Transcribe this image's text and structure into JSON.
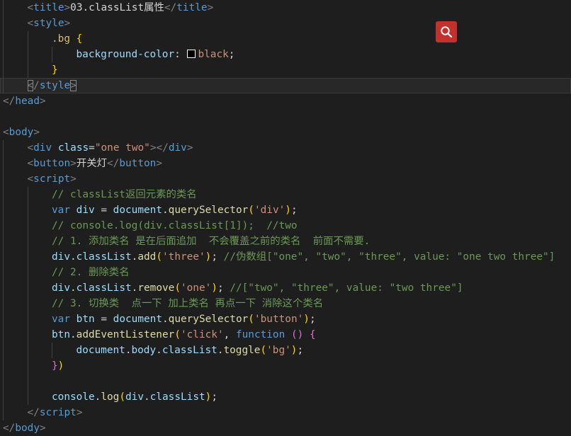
{
  "lines": [
    {
      "indent": 1,
      "tokens": [
        {
          "t": "<",
          "c": "t-tag"
        },
        {
          "t": "title",
          "c": "t-tagname"
        },
        {
          "t": ">",
          "c": "t-tag"
        },
        {
          "t": "03.classList属性",
          "c": "t-text"
        },
        {
          "t": "</",
          "c": "t-tag"
        },
        {
          "t": "title",
          "c": "t-tagname"
        },
        {
          "t": ">",
          "c": "t-tag"
        }
      ]
    },
    {
      "indent": 1,
      "tokens": [
        {
          "t": "<",
          "c": "t-tag"
        },
        {
          "t": "style",
          "c": "t-tagname"
        },
        {
          "t": ">",
          "c": "t-tag"
        }
      ]
    },
    {
      "indent": 2,
      "tokens": [
        {
          "t": ".bg",
          "c": "t-sel"
        },
        {
          "t": " ",
          "c": "t-punc"
        },
        {
          "t": "{",
          "c": "t-brace"
        }
      ]
    },
    {
      "indent": 3,
      "tokens": [
        {
          "t": "background-color",
          "c": "t-prop"
        },
        {
          "t": ": ",
          "c": "t-punc"
        },
        {
          "swatch": true
        },
        {
          "t": "black",
          "c": "t-str"
        },
        {
          "t": ";",
          "c": "t-punc"
        }
      ]
    },
    {
      "indent": 2,
      "tokens": [
        {
          "t": "}",
          "c": "t-brace"
        }
      ]
    },
    {
      "indent": 1,
      "current": true,
      "tokens": [
        {
          "t": "<",
          "c": "t-tag",
          "hl": true
        },
        {
          "t": "/",
          "c": "t-tag"
        },
        {
          "t": "style",
          "c": "t-tagname"
        },
        {
          "t": ">",
          "c": "t-tag",
          "hl": true
        }
      ]
    },
    {
      "indent": 0,
      "tokens": [
        {
          "t": "</",
          "c": "t-tag"
        },
        {
          "t": "head",
          "c": "t-tagname"
        },
        {
          "t": ">",
          "c": "t-tag"
        }
      ]
    },
    {
      "indent": 0,
      "tokens": []
    },
    {
      "indent": 0,
      "tokens": [
        {
          "t": "<",
          "c": "t-tag"
        },
        {
          "t": "body",
          "c": "t-tagname"
        },
        {
          "t": ">",
          "c": "t-tag"
        }
      ]
    },
    {
      "indent": 1,
      "tokens": [
        {
          "t": "<",
          "c": "t-tag"
        },
        {
          "t": "div",
          "c": "t-tagname"
        },
        {
          "t": " ",
          "c": "t-punc"
        },
        {
          "t": "class",
          "c": "t-attr"
        },
        {
          "t": "=",
          "c": "t-punc"
        },
        {
          "t": "\"one two\"",
          "c": "t-str"
        },
        {
          "t": "></",
          "c": "t-tag"
        },
        {
          "t": "div",
          "c": "t-tagname"
        },
        {
          "t": ">",
          "c": "t-tag"
        }
      ]
    },
    {
      "indent": 1,
      "tokens": [
        {
          "t": "<",
          "c": "t-tag"
        },
        {
          "t": "button",
          "c": "t-tagname"
        },
        {
          "t": ">",
          "c": "t-tag"
        },
        {
          "t": "开关灯",
          "c": "t-text"
        },
        {
          "t": "</",
          "c": "t-tag"
        },
        {
          "t": "button",
          "c": "t-tagname"
        },
        {
          "t": ">",
          "c": "t-tag"
        }
      ]
    },
    {
      "indent": 1,
      "tokens": [
        {
          "t": "<",
          "c": "t-tag"
        },
        {
          "t": "script",
          "c": "t-tagname"
        },
        {
          "t": ">",
          "c": "t-tag"
        }
      ]
    },
    {
      "indent": 2,
      "tokens": [
        {
          "t": "// classList返回元素的类名",
          "c": "t-com"
        }
      ]
    },
    {
      "indent": 2,
      "tokens": [
        {
          "t": "var",
          "c": "t-kw"
        },
        {
          "t": " ",
          "c": "t-punc"
        },
        {
          "t": "div",
          "c": "t-var"
        },
        {
          "t": " = ",
          "c": "t-punc"
        },
        {
          "t": "document",
          "c": "t-var"
        },
        {
          "t": ".",
          "c": "t-punc"
        },
        {
          "t": "querySelector",
          "c": "t-fn"
        },
        {
          "t": "(",
          "c": "t-brace"
        },
        {
          "t": "'div'",
          "c": "t-str"
        },
        {
          "t": ")",
          "c": "t-brace"
        },
        {
          "t": ";",
          "c": "t-punc"
        }
      ]
    },
    {
      "indent": 2,
      "tokens": [
        {
          "t": "// console.log(div.classList[1]);  //two",
          "c": "t-com"
        }
      ]
    },
    {
      "indent": 2,
      "tokens": [
        {
          "t": "// 1. 添加类名 是在后面追加  不会覆盖之前的类名  前面不需要.",
          "c": "t-com"
        }
      ]
    },
    {
      "indent": 2,
      "tokens": [
        {
          "t": "div",
          "c": "t-var"
        },
        {
          "t": ".",
          "c": "t-punc"
        },
        {
          "t": "classList",
          "c": "t-var"
        },
        {
          "t": ".",
          "c": "t-punc"
        },
        {
          "t": "add",
          "c": "t-fn"
        },
        {
          "t": "(",
          "c": "t-brace"
        },
        {
          "t": "'three'",
          "c": "t-str"
        },
        {
          "t": ")",
          "c": "t-brace"
        },
        {
          "t": "; ",
          "c": "t-punc"
        },
        {
          "t": "//伪数组[\"one\", \"two\", \"three\", value: \"one two three\"]",
          "c": "t-com"
        }
      ]
    },
    {
      "indent": 2,
      "tokens": [
        {
          "t": "// 2. 删除类名",
          "c": "t-com"
        }
      ]
    },
    {
      "indent": 2,
      "tokens": [
        {
          "t": "div",
          "c": "t-var"
        },
        {
          "t": ".",
          "c": "t-punc"
        },
        {
          "t": "classList",
          "c": "t-var"
        },
        {
          "t": ".",
          "c": "t-punc"
        },
        {
          "t": "remove",
          "c": "t-fn"
        },
        {
          "t": "(",
          "c": "t-brace"
        },
        {
          "t": "'one'",
          "c": "t-str"
        },
        {
          "t": ")",
          "c": "t-brace"
        },
        {
          "t": "; ",
          "c": "t-punc"
        },
        {
          "t": "//[\"two\", \"three\", value: \"two three\"]",
          "c": "t-com"
        }
      ]
    },
    {
      "indent": 2,
      "tokens": [
        {
          "t": "// 3. 切换类  点一下 加上类名 再点一下 消除这个类名",
          "c": "t-com"
        }
      ]
    },
    {
      "indent": 2,
      "tokens": [
        {
          "t": "var",
          "c": "t-kw"
        },
        {
          "t": " ",
          "c": "t-punc"
        },
        {
          "t": "btn",
          "c": "t-var"
        },
        {
          "t": " = ",
          "c": "t-punc"
        },
        {
          "t": "document",
          "c": "t-var"
        },
        {
          "t": ".",
          "c": "t-punc"
        },
        {
          "t": "querySelector",
          "c": "t-fn"
        },
        {
          "t": "(",
          "c": "t-brace"
        },
        {
          "t": "'button'",
          "c": "t-str"
        },
        {
          "t": ")",
          "c": "t-brace"
        },
        {
          "t": ";",
          "c": "t-punc"
        }
      ]
    },
    {
      "indent": 2,
      "tokens": [
        {
          "t": "btn",
          "c": "t-var"
        },
        {
          "t": ".",
          "c": "t-punc"
        },
        {
          "t": "addEventListener",
          "c": "t-fn"
        },
        {
          "t": "(",
          "c": "t-brace"
        },
        {
          "t": "'click'",
          "c": "t-str"
        },
        {
          "t": ", ",
          "c": "t-punc"
        },
        {
          "t": "function",
          "c": "t-kw"
        },
        {
          "t": " ",
          "c": "t-punc"
        },
        {
          "t": "()",
          "c": "t-paren"
        },
        {
          "t": " ",
          "c": "t-punc"
        },
        {
          "t": "{",
          "c": "t-paren"
        }
      ]
    },
    {
      "indent": 3,
      "tokens": [
        {
          "t": "document",
          "c": "t-var"
        },
        {
          "t": ".",
          "c": "t-punc"
        },
        {
          "t": "body",
          "c": "t-var"
        },
        {
          "t": ".",
          "c": "t-punc"
        },
        {
          "t": "classList",
          "c": "t-var"
        },
        {
          "t": ".",
          "c": "t-punc"
        },
        {
          "t": "toggle",
          "c": "t-fn"
        },
        {
          "t": "(",
          "c": "t-brace"
        },
        {
          "t": "'bg'",
          "c": "t-str"
        },
        {
          "t": ")",
          "c": "t-brace"
        },
        {
          "t": ";",
          "c": "t-punc"
        }
      ]
    },
    {
      "indent": 2,
      "tokens": [
        {
          "t": "}",
          "c": "t-paren"
        },
        {
          "t": ")",
          "c": "t-brace"
        }
      ]
    },
    {
      "indent": 2,
      "tokens": []
    },
    {
      "indent": 2,
      "tokens": [
        {
          "t": "console",
          "c": "t-var"
        },
        {
          "t": ".",
          "c": "t-punc"
        },
        {
          "t": "log",
          "c": "t-fn"
        },
        {
          "t": "(",
          "c": "t-brace"
        },
        {
          "t": "div",
          "c": "t-var"
        },
        {
          "t": ".",
          "c": "t-punc"
        },
        {
          "t": "classList",
          "c": "t-var"
        },
        {
          "t": ")",
          "c": "t-brace"
        },
        {
          "t": ";",
          "c": "t-punc"
        }
      ]
    },
    {
      "indent": 1,
      "tokens": [
        {
          "t": "</",
          "c": "t-tag"
        },
        {
          "t": "script",
          "c": "t-tagname"
        },
        {
          "t": ">",
          "c": "t-tag"
        }
      ]
    },
    {
      "indent": 0,
      "tokens": [
        {
          "t": "</",
          "c": "t-tag"
        },
        {
          "t": "body",
          "c": "t-tagname"
        },
        {
          "t": ">",
          "c": "t-tag"
        }
      ]
    }
  ],
  "search_button": {
    "icon": "search-icon"
  }
}
